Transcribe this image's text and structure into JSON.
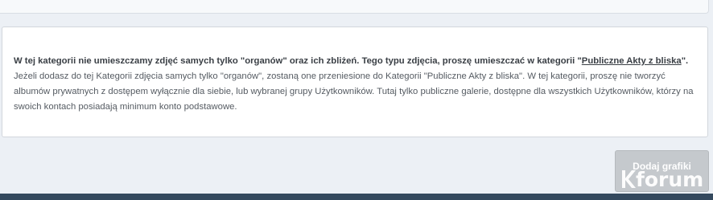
{
  "notice": {
    "bold_text": "W tej kategorii nie umieszczamy zdjęć samych tylko \"organów\" oraz ich zbliżeń. Tego typu zdjęcia, proszę umieszczać w kategorii \"",
    "link_text": "Publiczne Akty z bliska",
    "bold_tail": "\".",
    "body_text": "Jeżeli dodasz do tej Kategorii zdjęcia samych tylko \"organów\", zostaną one przeniesione do Kategorii \"Publiczne Akty z bliska\". W tej kategorii, proszę nie tworzyć albumów prywatnych z dostępem wyłącznie dla siebie, lub wybranej grupy Użytkowników. Tutaj tylko publiczne galerie, dostępne dla wszystkich Użytkowników, którzy na swoich kontach posiadają minimum konto podstawowe."
  },
  "add_button": {
    "label": "Dodaj grafiki"
  },
  "watermark": {
    "text": "forum"
  }
}
